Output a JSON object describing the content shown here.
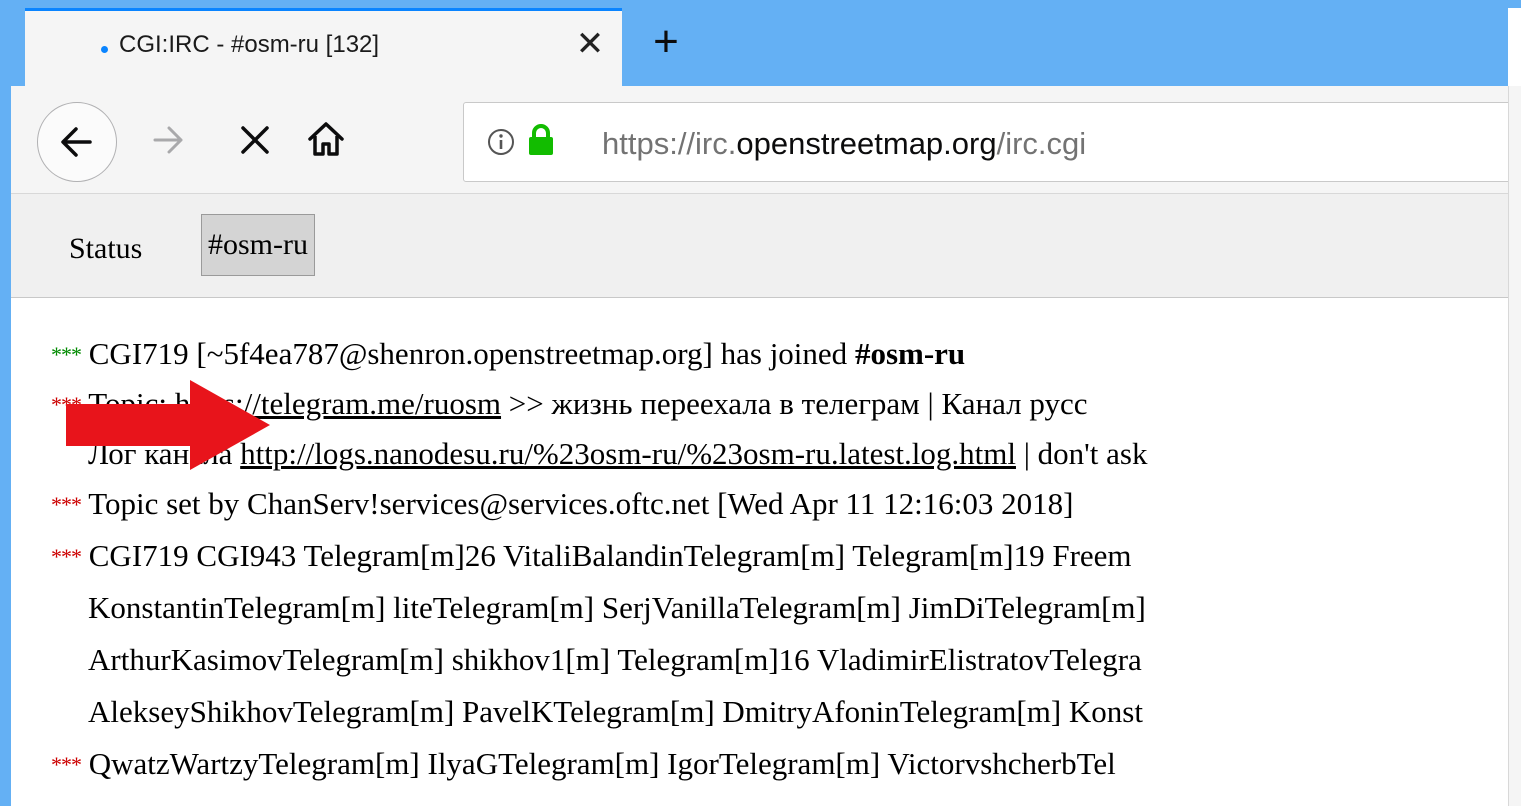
{
  "browser": {
    "tab": {
      "title": "CGI:IRC - #osm-ru [132]",
      "close_glyph": "✕"
    },
    "new_tab_glyph": "+",
    "url": {
      "scheme_prefix": "https://irc.",
      "host": "openstreetmap.org",
      "path": "/irc.cgi"
    }
  },
  "irc": {
    "tabs": [
      {
        "label": "Status",
        "active": false
      },
      {
        "label": "#osm-ru",
        "active": true
      }
    ],
    "stars": "***",
    "lines": [
      {
        "pre": "CGI719 [~5f4ea787@shenron.openstreetmap.org] has joined ",
        "bold": "#osm-ru"
      },
      {
        "pre": "Topic: ",
        "link": "https://telegram.me/ruosm",
        "post": " >> жизнь переехала в телеграм | Канал русс"
      },
      {
        "pre": "Лог канала ",
        "link": "http://logs.nanodesu.ru/%23osm-ru/%23osm-ru.latest.log.html",
        "post": " | don't ask"
      },
      {
        "pre": "Topic set by ChanServ!services@services.oftc.net [Wed Apr 11 12:16:03 2018]"
      },
      {
        "pre": "CGI719 CGI943 Telegram[m]26 VitaliBalandinTelegram[m] Telegram[m]19 Freem"
      },
      {
        "pre": "KonstantinTelegram[m] liteTelegram[m] SerjVanillaTelegram[m] JimDiTelegram[m]"
      },
      {
        "pre": "ArthurKasimovTelegram[m] shikhov1[m] Telegram[m]16 VladimirElistratovTelegra"
      },
      {
        "pre": "AlekseyShikhovTelegram[m] PavelKTelegram[m] DmitryAfoninTelegram[m] Konst"
      },
      {
        "pre": "QwatzWartzyTelegram[m] IlyaGTelegram[m] IgorTelegram[m] VictorvshcherbTel"
      }
    ]
  },
  "colors": {
    "accent": "#64b0f4",
    "join_stars": "#008a00",
    "info_stars": "#cc0000",
    "lock": "#12bc00",
    "annotation_arrow": "#e8141b"
  },
  "icons": [
    "back-arrow-icon",
    "forward-arrow-icon",
    "stop-icon",
    "home-icon",
    "info-icon",
    "lock-icon"
  ]
}
